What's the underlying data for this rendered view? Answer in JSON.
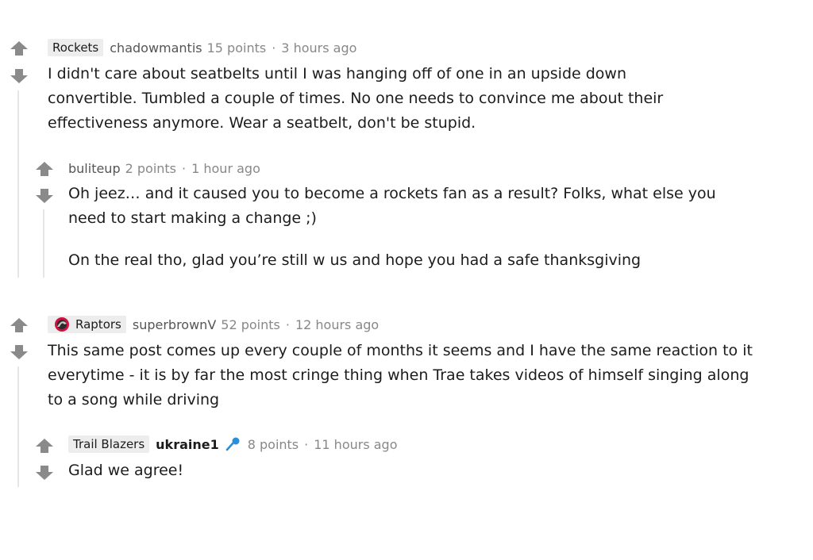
{
  "comments": [
    {
      "flair": "Rockets",
      "author": "chadowmantis",
      "points": "15 points",
      "separator": "·",
      "time": "3 hours ago",
      "body": "I didn't care about seatbelts until I was hanging off of one in an upside down convertible. Tumbled a couple of times. No one needs to convince me about their effectiveness anymore. Wear a seatbelt, don't be stupid.",
      "reply": {
        "author": "buliteup",
        "points": "2 points",
        "separator": "·",
        "time": "1 hour ago",
        "paragraphs": [
          "Oh jeez… and it caused you to become a rockets fan as a result? Folks, what else you need to start making a change ;)",
          "On the real tho, glad you’re still w us and hope you had a safe thanksgiving"
        ]
      }
    },
    {
      "flair": "Raptors",
      "author": "superbrownV",
      "points": "52 points",
      "separator": "·",
      "time": "12 hours ago",
      "body": "This same post comes up every couple of months it seems and I have the same reaction to it everytime - it is by far the most cringe thing when Trae takes videos of himself singing along to a song while driving",
      "reply": {
        "flair": "Trail Blazers",
        "author": "ukraine1",
        "points": "8 points",
        "separator": "·",
        "time": "11 hours ago",
        "paragraphs": [
          "Glad we agree!"
        ]
      }
    }
  ],
  "icons": {
    "upvote": "arrow-up-icon",
    "downvote": "arrow-down-icon",
    "flair_logo": "raptors-logo-icon",
    "author_badge": "microphone-icon"
  },
  "colors": {
    "arrow": "#8a8a8a",
    "thread_line": "#e6e6e6",
    "flair_bg": "#ededed",
    "meta_text": "#888888",
    "mic": "#2a8fd8"
  }
}
